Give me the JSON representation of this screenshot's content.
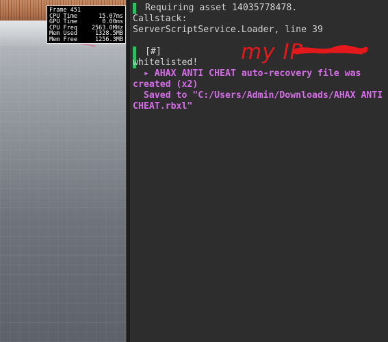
{
  "stats": {
    "frame": "Frame 451",
    "rows": [
      {
        "label": "CPU Time",
        "value": "15.07ms"
      },
      {
        "label": "GPU Time",
        "value": "0.00ms"
      },
      {
        "label": "CPU Freq",
        "value": "2563.0MHz"
      },
      {
        "label": "Mem Used",
        "value": "1328.5MB"
      },
      {
        "label": "Mem Free",
        "value": "1256.3MB"
      }
    ]
  },
  "console": {
    "entry1": {
      "line1": " Requiring asset 14035778478.",
      "line2": "Callstack:",
      "line3": "ServerScriptService.Loader, line 39"
    },
    "entry2": {
      "prefix": " [#]",
      "annotation": "my IP",
      "line2": "whitelisted!",
      "line3_arrow": "▸",
      "line3": " AHAX ANTI CHEAT auto-recovery file was",
      "line4": "created (x2)",
      "line5": "  Saved to \"C:/Users/Admin/Downloads/AHAX ANTI",
      "line6": "CHEAT.rbxl\""
    }
  },
  "colors": {
    "marker": "#2fbd63",
    "warning_text": "#d46ee6",
    "annotation": "#e4191c"
  }
}
